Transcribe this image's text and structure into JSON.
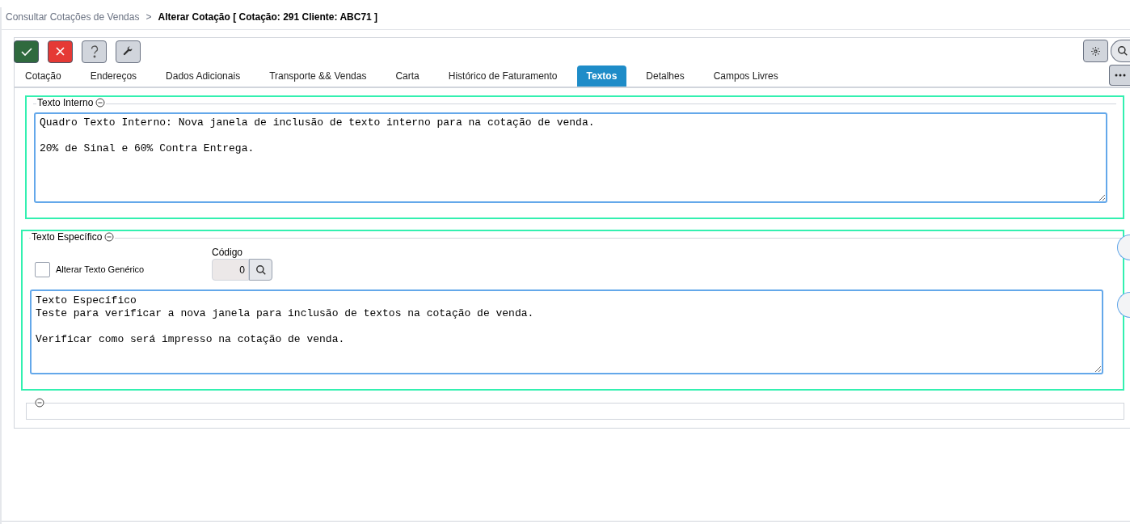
{
  "breadcrumb": {
    "parent": "Consultar Cotações de Vendas",
    "separator": ">",
    "current": "Alterar Cotação [ Cotação: 291 Cliente: ABC71 ]"
  },
  "toolbar": [
    {
      "kind": "confirm"
    },
    {
      "kind": "cancel"
    },
    {
      "kind": "help"
    },
    {
      "kind": "tools"
    }
  ],
  "tabs": [
    {
      "label": "Cotação",
      "selected": false
    },
    {
      "label": "Endereços",
      "selected": false
    },
    {
      "label": "Dados Adicionais",
      "selected": false
    },
    {
      "label": "Transporte && Vendas",
      "selected": false
    },
    {
      "label": "Carta",
      "selected": false
    },
    {
      "label": "Histórico de Faturamento",
      "selected": false
    },
    {
      "label": "Textos",
      "selected": true
    },
    {
      "label": "Detalhes",
      "selected": false
    },
    {
      "label": "Campos Livres",
      "selected": false
    }
  ],
  "texto_interno": {
    "title": "Texto Interno",
    "value": "Quadro Texto Interno: Nova janela de inclusão de texto interno para na cotação de venda.\n\n20% de Sinal e 60% Contra Entrega."
  },
  "texto_especifico": {
    "title": "Texto Específico",
    "checkbox": {
      "label": "Alterar Texto Genérico",
      "checked": false
    },
    "codigo": {
      "label": "Código",
      "value": "0"
    },
    "value": "Texto Específico\nTeste para verificar a nova janela para inclusão de textos na cotação de venda.\n\nVerificar como será impresso na cotação de venda."
  }
}
